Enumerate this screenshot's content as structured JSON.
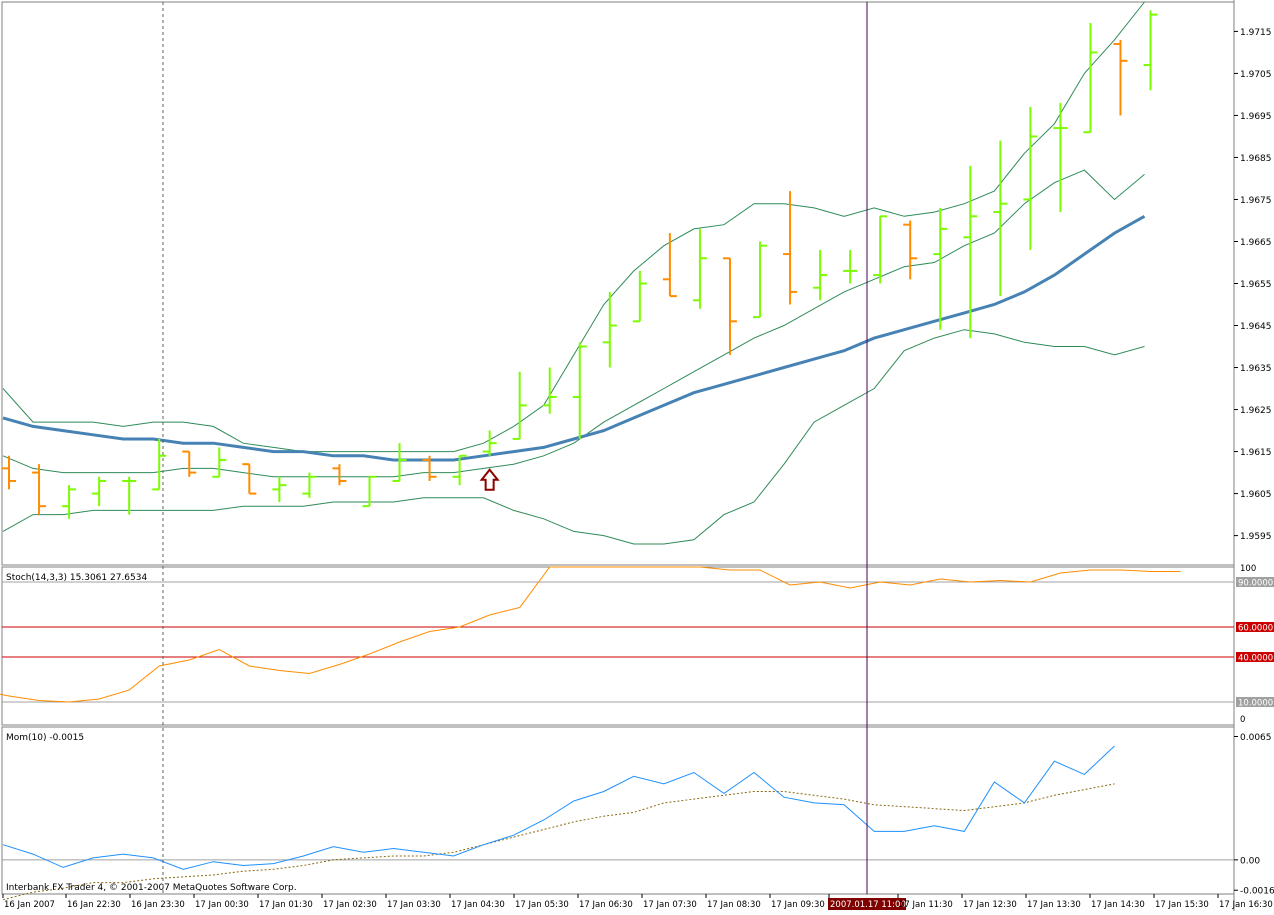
{
  "chart_data": {
    "type": "line",
    "panels": [
      {
        "name": "price",
        "kind": "ohlc",
        "ylim": [
          1.9588,
          1.9722
        ],
        "y_ticks": [
          "1.9595",
          "1.9605",
          "1.9615",
          "1.9625",
          "1.9635",
          "1.9645",
          "1.9655",
          "1.9665",
          "1.9675",
          "1.9685",
          "1.9695",
          "1.9705",
          "1.9715"
        ],
        "bars": [
          {
            "o": 1.9611,
            "h": 1.9614,
            "l": 1.9606,
            "c": 1.9608
          },
          {
            "o": 1.961,
            "h": 1.9612,
            "l": 1.96,
            "c": 1.9602
          },
          {
            "o": 1.9602,
            "h": 1.9607,
            "l": 1.9599,
            "c": 1.9606
          },
          {
            "o": 1.9605,
            "h": 1.9609,
            "l": 1.9602,
            "c": 1.9608
          },
          {
            "o": 1.9608,
            "h": 1.9609,
            "l": 1.96,
            "c": 1.9608
          },
          {
            "o": 1.9606,
            "h": 1.9618,
            "l": 1.9606,
            "c": 1.9614
          },
          {
            "o": 1.9615,
            "h": 1.9615,
            "l": 1.9609,
            "c": 1.961
          },
          {
            "o": 1.9609,
            "h": 1.9616,
            "l": 1.9609,
            "c": 1.9613
          },
          {
            "o": 1.9612,
            "h": 1.9612,
            "l": 1.9605,
            "c": 1.9605
          },
          {
            "o": 1.9606,
            "h": 1.9609,
            "l": 1.9603,
            "c": 1.9607
          },
          {
            "o": 1.9605,
            "h": 1.961,
            "l": 1.9604,
            "c": 1.9609
          },
          {
            "o": 1.9611,
            "h": 1.9612,
            "l": 1.9607,
            "c": 1.9608
          },
          {
            "o": 1.9602,
            "h": 1.9609,
            "l": 1.9602,
            "c": 1.9609
          },
          {
            "o": 1.9608,
            "h": 1.9617,
            "l": 1.9608,
            "c": 1.9613
          },
          {
            "o": 1.9613,
            "h": 1.9614,
            "l": 1.9608,
            "c": 1.9609
          },
          {
            "o": 1.9609,
            "h": 1.9614,
            "l": 1.9607,
            "c": 1.9614
          },
          {
            "o": 1.9615,
            "h": 1.962,
            "l": 1.9614,
            "c": 1.9617
          },
          {
            "o": 1.9618,
            "h": 1.9634,
            "l": 1.9618,
            "c": 1.9626
          },
          {
            "o": 1.9626,
            "h": 1.9635,
            "l": 1.9624,
            "c": 1.9628
          },
          {
            "o": 1.9628,
            "h": 1.9641,
            "l": 1.9618,
            "c": 1.964
          },
          {
            "o": 1.9641,
            "h": 1.9653,
            "l": 1.9635,
            "c": 1.9645
          },
          {
            "o": 1.9646,
            "h": 1.9658,
            "l": 1.9646,
            "c": 1.9655
          },
          {
            "o": 1.9656,
            "h": 1.9667,
            "l": 1.9652,
            "c": 1.9652
          },
          {
            "o": 1.9651,
            "h": 1.9668,
            "l": 1.9649,
            "c": 1.9661
          },
          {
            "o": 1.9661,
            "h": 1.9661,
            "l": 1.9638,
            "c": 1.9646
          },
          {
            "o": 1.9647,
            "h": 1.9665,
            "l": 1.9647,
            "c": 1.9664
          },
          {
            "o": 1.9662,
            "h": 1.9677,
            "l": 1.965,
            "c": 1.9653
          },
          {
            "o": 1.9654,
            "h": 1.9663,
            "l": 1.9651,
            "c": 1.9657
          },
          {
            "o": 1.9658,
            "h": 1.9663,
            "l": 1.9655,
            "c": 1.9658
          },
          {
            "o": 1.9657,
            "h": 1.9671,
            "l": 1.9655,
            "c": 1.9671
          },
          {
            "o": 1.9669,
            "h": 1.967,
            "l": 1.9656,
            "c": 1.9661
          },
          {
            "o": 1.9662,
            "h": 1.9673,
            "l": 1.9644,
            "c": 1.9668
          },
          {
            "o": 1.9666,
            "h": 1.9683,
            "l": 1.9642,
            "c": 1.9671
          },
          {
            "o": 1.9672,
            "h": 1.9689,
            "l": 1.9652,
            "c": 1.9674
          },
          {
            "o": 1.9675,
            "h": 1.9697,
            "l": 1.9663,
            "c": 1.969
          },
          {
            "o": 1.9692,
            "h": 1.9698,
            "l": 1.9672,
            "c": 1.9692
          },
          {
            "o": 1.9691,
            "h": 1.9717,
            "l": 1.9691,
            "c": 1.971
          },
          {
            "o": 1.9712,
            "h": 1.9713,
            "l": 1.9695,
            "c": 1.9708
          },
          {
            "o": 1.9707,
            "h": 1.972,
            "l": 1.9701,
            "c": 1.9719
          }
        ],
        "ma_thick": [
          1.9623,
          1.9621,
          1.962,
          1.9619,
          1.9618,
          1.9618,
          1.9617,
          1.9617,
          1.9616,
          1.9615,
          1.9615,
          1.9614,
          1.9614,
          1.9613,
          1.9613,
          1.9613,
          1.9614,
          1.9615,
          1.9616,
          1.9618,
          1.962,
          1.9623,
          1.9626,
          1.9629,
          1.9631,
          1.9633,
          1.9635,
          1.9637,
          1.9639,
          1.9642,
          1.9644,
          1.9646,
          1.9648,
          1.965,
          1.9653,
          1.9657,
          1.9662,
          1.9667,
          1.9671
        ],
        "bb_upper": [
          1.963,
          1.9622,
          1.9622,
          1.9622,
          1.9621,
          1.9622,
          1.9622,
          1.9621,
          1.9617,
          1.9616,
          1.9615,
          1.9615,
          1.9615,
          1.9615,
          1.9615,
          1.9615,
          1.9617,
          1.9621,
          1.9626,
          1.9638,
          1.965,
          1.9658,
          1.9664,
          1.9668,
          1.9669,
          1.9674,
          1.9674,
          1.9673,
          1.9671,
          1.9673,
          1.9671,
          1.9672,
          1.9674,
          1.9677,
          1.9686,
          1.9693,
          1.9705,
          1.9713,
          1.9722
        ],
        "bb_mid": [
          1.9614,
          1.9611,
          1.961,
          1.961,
          1.961,
          1.961,
          1.9611,
          1.9611,
          1.961,
          1.9609,
          1.9609,
          1.9609,
          1.9609,
          1.9609,
          1.961,
          1.961,
          1.9611,
          1.9612,
          1.9614,
          1.9617,
          1.9622,
          1.9626,
          1.963,
          1.9634,
          1.9638,
          1.9642,
          1.9645,
          1.9649,
          1.9653,
          1.9656,
          1.9659,
          1.966,
          1.9664,
          1.9667,
          1.9674,
          1.9679,
          1.9682,
          1.9675,
          1.9681
        ],
        "bb_lower": [
          1.9596,
          1.96,
          1.96,
          1.9601,
          1.9601,
          1.9601,
          1.9601,
          1.9601,
          1.9602,
          1.9602,
          1.9602,
          1.9603,
          1.9603,
          1.9603,
          1.9604,
          1.9604,
          1.9604,
          1.9601,
          1.9599,
          1.9596,
          1.9595,
          1.9593,
          1.9593,
          1.9594,
          1.96,
          1.9603,
          1.9612,
          1.9622,
          1.9626,
          1.963,
          1.9639,
          1.9642,
          1.9644,
          1.9643,
          1.9641,
          1.964,
          1.964,
          1.9638,
          1.964
        ],
        "arrow_bar_index": 16
      },
      {
        "name": "stochastic",
        "label": "Stoch(14,3,3) 15.3061 27.6534",
        "ylim": [
          0,
          100
        ],
        "levels": [
          {
            "value": 90,
            "label": "90.0000",
            "color": "#a0a0a0"
          },
          {
            "value": 60,
            "label": "60.0000",
            "color": "#cc0000"
          },
          {
            "value": 40,
            "label": "40.0000",
            "color": "#cc0000"
          },
          {
            "value": 10,
            "label": "10.0000",
            "color": "#a0a0a0"
          }
        ],
        "tick_top": "100",
        "tick_bottom": "0",
        "values": [
          18,
          14,
          11,
          10,
          12,
          18,
          34,
          38,
          45,
          34,
          31,
          29,
          35,
          42,
          50,
          57,
          60,
          68,
          73,
          100,
          100,
          100,
          100,
          100,
          100,
          98,
          98,
          88,
          90,
          86,
          90,
          88,
          92,
          90,
          91,
          90,
          96,
          98,
          98,
          97,
          97
        ]
      },
      {
        "name": "momentum",
        "label": "Mom(10) -0.0015",
        "ylim": [
          -0.0018,
          0.007
        ],
        "tick_labels": [
          "0.0065",
          "0.00",
          "-0.0016"
        ],
        "tick_values": [
          0.0065,
          0.0,
          -0.0016
        ],
        "momentum": [
          0.0008,
          0.0003,
          -0.0004,
          0.0001,
          0.0003,
          0.0001,
          -0.0005,
          -0.0001,
          -0.0003,
          -0.0002,
          0.0002,
          0.0007,
          0.0004,
          0.0006,
          0.0004,
          0.0002,
          0.0008,
          0.0013,
          0.0021,
          0.0031,
          0.0036,
          0.0044,
          0.004,
          0.0046,
          0.0035,
          0.0046,
          0.0033,
          0.003,
          0.0029,
          0.0015,
          0.0015,
          0.0018,
          0.0015,
          0.0041,
          0.003,
          0.0052,
          0.0045,
          0.006
        ],
        "signal": [
          -0.0021,
          -0.0017,
          -0.0015,
          -0.0012,
          -0.0012,
          -0.001,
          -0.0009,
          -0.0008,
          -0.0006,
          -0.0005,
          -0.0003,
          0.0,
          0.0001,
          0.0002,
          0.0002,
          0.0004,
          0.0008,
          0.0012,
          0.0016,
          0.002,
          0.0023,
          0.0025,
          0.003,
          0.0032,
          0.0034,
          0.0036,
          0.0036,
          0.0034,
          0.0032,
          0.0029,
          0.0028,
          0.0027,
          0.0026,
          0.0028,
          0.003,
          0.0034,
          0.0037,
          0.004
        ]
      }
    ],
    "x_labels": [
      "16 Jan 2007",
      "16 Jan 22:30",
      "16 Jan 23:30",
      "17 Jan 00:30",
      "17 Jan 01:30",
      "17 Jan 02:30",
      "17 Jan 03:30",
      "17 Jan 04:30",
      "17 Jan 05:30",
      "17 Jan 06:30",
      "17 Jan 07:30",
      "17 Jan 08:30",
      "17 Jan 09:30",
      "2007.01.17 11:00",
      "17 Jan 11:30",
      "17 Jan 12:30",
      "17 Jan 13:30",
      "17 Jan 14:30",
      "17 Jan 15:30",
      "17 Jan 16:30"
    ],
    "cursor_label": "2007.01.17 11:00",
    "copyright": "Interbank FX Trader 4, © 2001-2007 MetaQuotes Software Corp.",
    "colors": {
      "bull": "#7cfc00",
      "bear": "#ff8c00",
      "ma_thick": "#4682b4",
      "bands": "#2e8b57",
      "stoch": "#ff8c00",
      "momentum": "#1e90ff",
      "signal": "#8b6914",
      "cursor": "#4b0055",
      "cursor_tag_bg": "#800000",
      "arrow": "#8b0000"
    }
  }
}
